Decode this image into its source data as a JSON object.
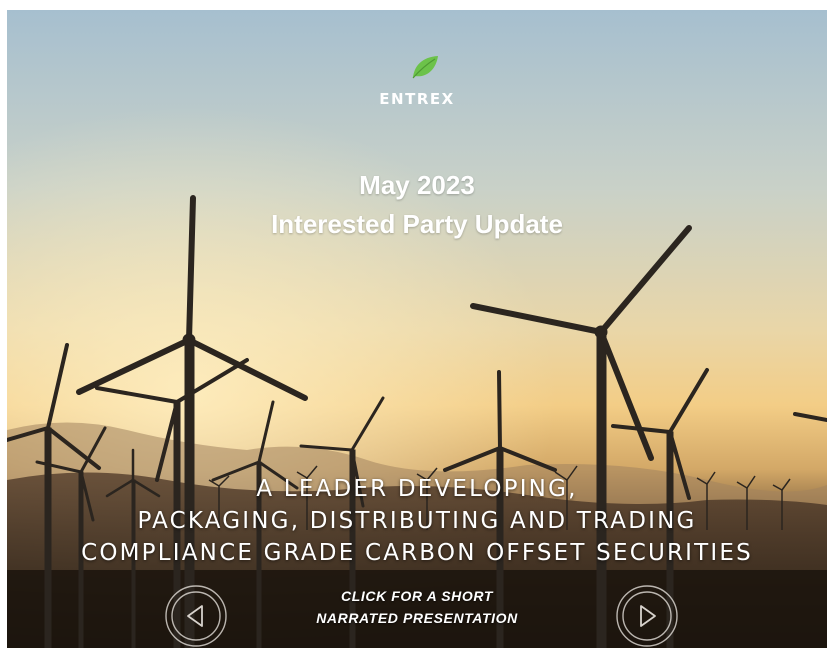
{
  "brand": {
    "name": "ENTREX",
    "logo_icon": "leaf-icon",
    "leaf_color": "#6cc24a"
  },
  "heading": {
    "date": "May 2023",
    "title": "Interested Party Update"
  },
  "tagline": {
    "line1": "A LEADER DEVELOPING,",
    "line2": "PACKAGING, DISTRIBUTING AND TRADING",
    "line3": "COMPLIANCE GRADE CARBON OFFSET SECURITIES"
  },
  "cta": {
    "line1": "CLICK FOR A SHORT",
    "line2": "NARRATED PRESENTATION"
  },
  "nav": {
    "prev_icon": "previous-arrow-icon",
    "next_icon": "next-arrow-icon"
  },
  "background": {
    "subject": "wind-turbines-sunset-photo",
    "sky_top": "#a9c1cf",
    "sky_glow": "#f4ce86",
    "ground": "#2a1e12"
  }
}
